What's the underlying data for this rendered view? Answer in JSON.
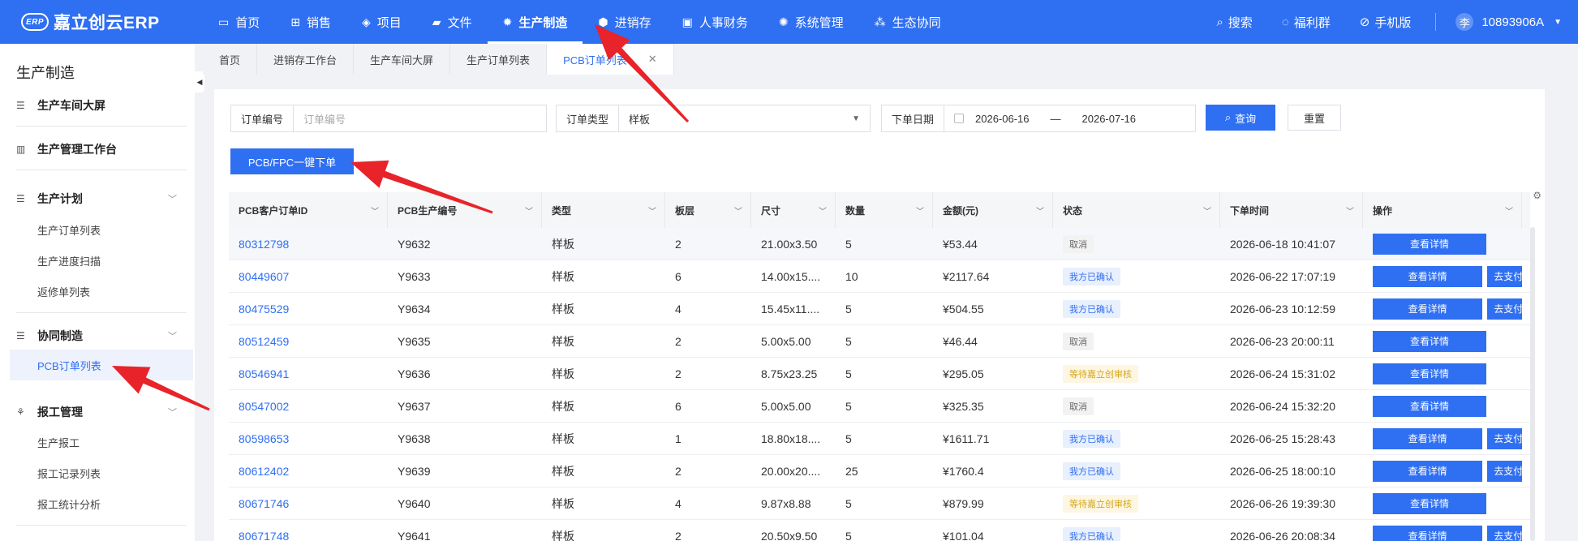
{
  "app": {
    "logo_text": "嘉立创云ERP",
    "logo_mark": "ERP",
    "brand_color": "#2f6ff2"
  },
  "nav": {
    "items": [
      {
        "label": "首页",
        "icon": "monitor-icon",
        "glyph": "▭"
      },
      {
        "label": "销售",
        "icon": "cart-icon",
        "glyph": "⊞"
      },
      {
        "label": "项目",
        "icon": "layers-icon",
        "glyph": "◈"
      },
      {
        "label": "文件",
        "icon": "folder-icon",
        "glyph": "▰"
      },
      {
        "label": "生产制造",
        "icon": "gear-icon",
        "glyph": "✹",
        "active": true
      },
      {
        "label": "进销存",
        "icon": "cube-icon",
        "glyph": "⬢"
      },
      {
        "label": "人事财务",
        "icon": "ledger-icon",
        "glyph": "▣"
      },
      {
        "label": "系统管理",
        "icon": "settings-icon",
        "glyph": "✺"
      },
      {
        "label": "生态协同",
        "icon": "cluster-icon",
        "glyph": "⁂"
      }
    ],
    "right": [
      {
        "label": "搜索",
        "icon": "search-icon",
        "glyph": "⌕"
      },
      {
        "label": "福利群",
        "icon": "group-chat-icon",
        "glyph": "◌"
      },
      {
        "label": "手机版",
        "icon": "mobile-icon",
        "glyph": "⊘"
      }
    ],
    "user": {
      "avatar": "李",
      "name": "10893906A"
    }
  },
  "sidebar": {
    "title": "生产制造",
    "groups": {
      "workshop_screen": "生产车间大屏",
      "mgmt_workbench": "生产管理工作台",
      "plan": "生产计划",
      "plan_items": [
        "生产订单列表",
        "生产进度扫描",
        "返修单列表"
      ],
      "collab": "协同制造",
      "collab_items": [
        "PCB订单列表"
      ],
      "report": "报工管理",
      "report_items": [
        "生产报工",
        "报工记录列表",
        "报工统计分析"
      ]
    }
  },
  "tabs": [
    {
      "label": "首页"
    },
    {
      "label": "进销存工作台"
    },
    {
      "label": "生产车间大屏"
    },
    {
      "label": "生产订单列表"
    },
    {
      "label": "PCB订单列表",
      "active": true,
      "closable": true
    }
  ],
  "filters": {
    "order_no_label": "订单编号",
    "order_no_placeholder": "订单编号",
    "order_type_label": "订单类型",
    "order_type_value": "样板",
    "date_label": "下单日期",
    "date_start": "2026-06-16",
    "date_sep": "—",
    "date_end": "2026-07-16",
    "query_button": "查询",
    "reset_button": "重置"
  },
  "actions": {
    "one_click_order": "PCB/FPC一键下单"
  },
  "table": {
    "columns": [
      "PCB客户订单ID",
      "PCB生产编号",
      "类型",
      "板层",
      "尺寸",
      "数量",
      "金额(元)",
      "状态",
      "下单时间",
      "操作"
    ],
    "detail_label": "查看详情",
    "pay_label": "去支付",
    "rows": [
      {
        "id": "80312798",
        "prod_no": "Y9632",
        "type": "样板",
        "layers": "2",
        "size": "21.00x3.50",
        "qty": "5",
        "amount": "¥53.44",
        "status": "取消",
        "status_kind": "cancel",
        "time": "2026-06-18 10:41:07",
        "pay": false
      },
      {
        "id": "80449607",
        "prod_no": "Y9633",
        "type": "样板",
        "layers": "6",
        "size": "14.00x15....",
        "qty": "10",
        "amount": "¥2117.64",
        "status": "我方已确认",
        "status_kind": "confirmed",
        "time": "2026-06-22 17:07:19",
        "pay": true
      },
      {
        "id": "80475529",
        "prod_no": "Y9634",
        "type": "样板",
        "layers": "4",
        "size": "15.45x11....",
        "qty": "5",
        "amount": "¥504.55",
        "status": "我方已确认",
        "status_kind": "confirmed",
        "time": "2026-06-23 10:12:59",
        "pay": true
      },
      {
        "id": "80512459",
        "prod_no": "Y9635",
        "type": "样板",
        "layers": "2",
        "size": "5.00x5.00",
        "qty": "5",
        "amount": "¥46.44",
        "status": "取消",
        "status_kind": "cancel",
        "time": "2026-06-23 20:00:11",
        "pay": false
      },
      {
        "id": "80546941",
        "prod_no": "Y9636",
        "type": "样板",
        "layers": "2",
        "size": "8.75x23.25",
        "qty": "5",
        "amount": "¥295.05",
        "status": "等待嘉立创审核",
        "status_kind": "pending",
        "time": "2026-06-24 15:31:02",
        "pay": false
      },
      {
        "id": "80547002",
        "prod_no": "Y9637",
        "type": "样板",
        "layers": "6",
        "size": "5.00x5.00",
        "qty": "5",
        "amount": "¥325.35",
        "status": "取消",
        "status_kind": "cancel",
        "time": "2026-06-24 15:32:20",
        "pay": false
      },
      {
        "id": "80598653",
        "prod_no": "Y9638",
        "type": "样板",
        "layers": "1",
        "size": "18.80x18....",
        "qty": "5",
        "amount": "¥1611.71",
        "status": "我方已确认",
        "status_kind": "confirmed",
        "time": "2026-06-25 15:28:43",
        "pay": true
      },
      {
        "id": "80612402",
        "prod_no": "Y9639",
        "type": "样板",
        "layers": "2",
        "size": "20.00x20....",
        "qty": "25",
        "amount": "¥1760.4",
        "status": "我方已确认",
        "status_kind": "confirmed",
        "time": "2026-06-25 18:00:10",
        "pay": true
      },
      {
        "id": "80671746",
        "prod_no": "Y9640",
        "type": "样板",
        "layers": "4",
        "size": "9.87x8.88",
        "qty": "5",
        "amount": "¥879.99",
        "status": "等待嘉立创审核",
        "status_kind": "pending",
        "time": "2026-06-26 19:39:30",
        "pay": false
      },
      {
        "id": "80671748",
        "prod_no": "Y9641",
        "type": "样板",
        "layers": "2",
        "size": "20.50x9.50",
        "qty": "5",
        "amount": "¥101.04",
        "status": "我方已确认",
        "status_kind": "confirmed",
        "time": "2026-06-26 20:08:34",
        "pay": true
      }
    ]
  },
  "annotation_color": "#e8232a"
}
